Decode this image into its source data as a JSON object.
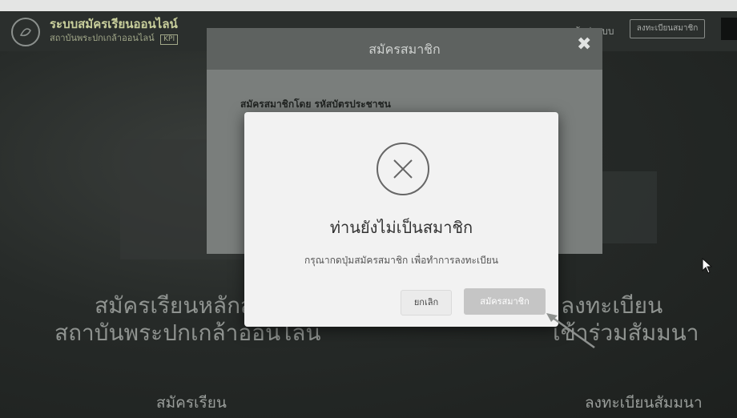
{
  "header": {
    "title": "ระบบสมัครเรียนออนไลน์",
    "subtitle": "สถาบันพระปกเกล้าออนไลน์",
    "badge": "KPI",
    "login_label": "เข้าสู่ระบบ",
    "register_label": "ลงทะเบียนสมาชิก",
    "logo_icon": "logo-icon"
  },
  "hero": {
    "left_line1": "สมัครเรียนหลักสูตร",
    "left_line2": "สถาบันพระปกเกล้าออนไลน์",
    "right_line1": "ลงทะเบียน",
    "right_line2": "เข้าร่วมสัมมนา",
    "left_link": "สมัครเรียน",
    "right_link": "ลงทะเบียนสัมมนา"
  },
  "register_modal": {
    "title": "สมัครสมาชิก",
    "close_glyph": "✖",
    "subtitle": "สมัครสมาชิกโดย รหัสบัตรประชาชน"
  },
  "alert": {
    "icon": "x-circle-icon",
    "title": "ท่านยังไม่เป็นสมาชิก",
    "message": "กรุณากดปุ่มสมัครสมาชิก เพื่อทำการลงทะเบียน",
    "cancel_label": "ยกเลิก",
    "confirm_label": "สมัครสมาชิก"
  },
  "colors": {
    "overlay": "#232725",
    "dialog_bg": "#f2f2f2",
    "confirm_button": "#c5c5c5"
  }
}
